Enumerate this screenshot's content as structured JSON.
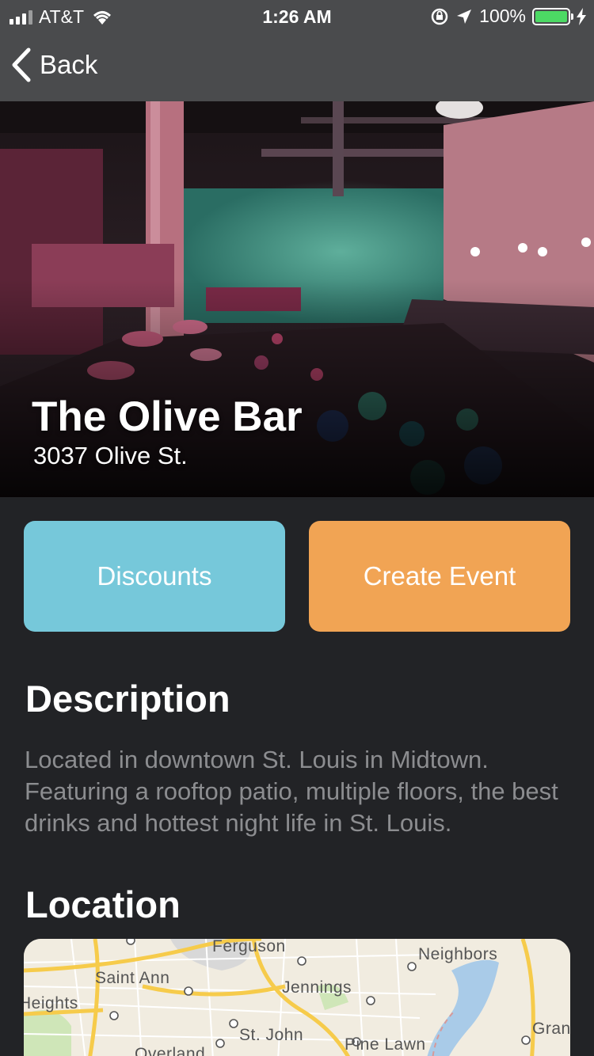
{
  "status_bar": {
    "carrier": "AT&T",
    "time": "1:26 AM",
    "battery_percent": "100%",
    "battery_level": 1.0
  },
  "nav": {
    "back_label": "Back",
    "back_icon": "chevron-left-icon"
  },
  "venue": {
    "name": "The Olive Bar",
    "address": "3037 Olive St."
  },
  "actions": {
    "discounts_label": "Discounts",
    "create_event_label": "Create Event"
  },
  "colors": {
    "discounts": "#76c8da",
    "create_event": "#f1a454",
    "background": "#222326",
    "nav": "#4a4b4d"
  },
  "description": {
    "heading": "Description",
    "text": "Located in downtown St. Louis in Midtown. Featuring a rooftop patio, multiple floors, the best drinks and hottest night life in St. Louis."
  },
  "location": {
    "heading": "Location",
    "map_labels": [
      "Ferguson",
      "Saint Ann",
      "Jennings",
      "Neighbors",
      "Heights",
      "St. John",
      "Pine Lawn",
      "Overland",
      "Gran"
    ]
  }
}
